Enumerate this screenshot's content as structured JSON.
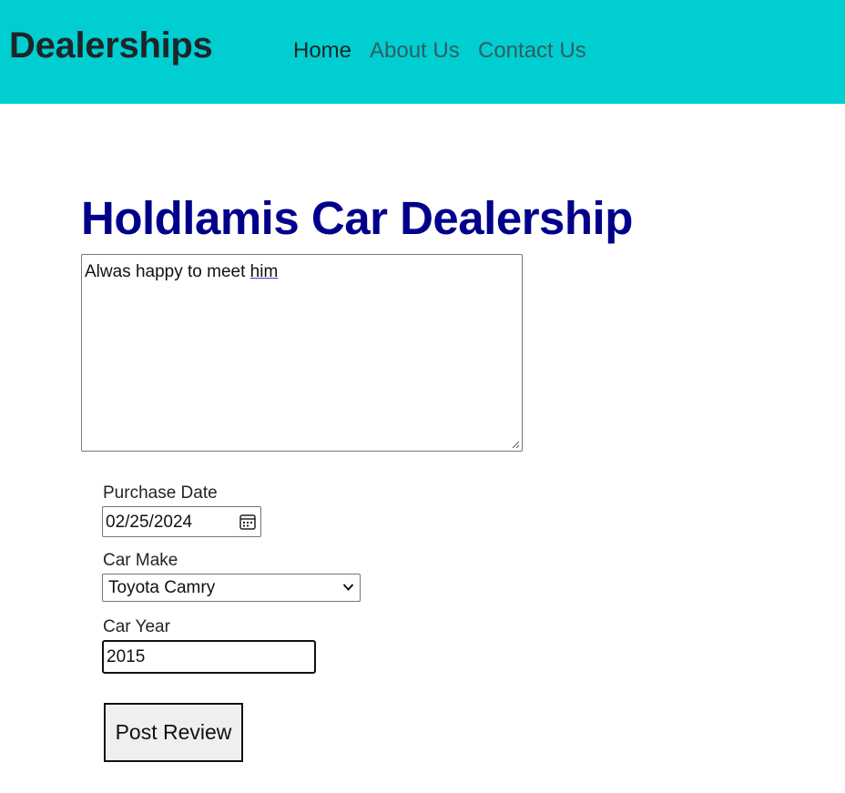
{
  "navbar": {
    "brand": "Dealerships",
    "links": [
      {
        "label": "Home",
        "active": true
      },
      {
        "label": "About Us",
        "active": false
      },
      {
        "label": "Contact Us",
        "active": false
      }
    ],
    "background_color": "#00ced1"
  },
  "dealer": {
    "name": "Holdlamis Car Dealership",
    "name_color": "#00008b"
  },
  "review": {
    "text_before": "Alwas happy to meet ",
    "text_underlined": "him"
  },
  "form": {
    "purchase_date_label": "Purchase Date",
    "purchase_date_value": "02/25/2024",
    "car_make_label": "Car Make",
    "car_make_selected": "Toyota Camry",
    "car_year_label": "Car Year",
    "car_year_value": "2015",
    "submit_label": "Post Review"
  },
  "icons": {
    "date_picker": "calendar-icon",
    "select_arrow": "chevron-down-icon"
  }
}
